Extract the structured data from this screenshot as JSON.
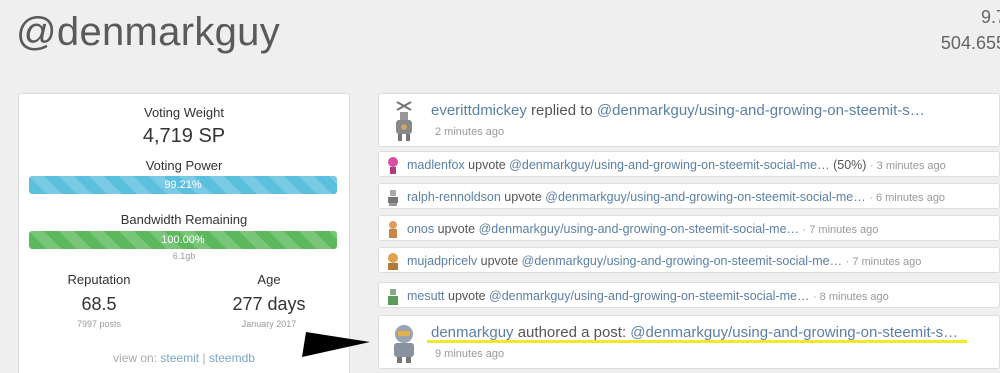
{
  "header": {
    "username": "@denmarkguy",
    "top_right_line1": "9.7",
    "top_right_line2": "504.655"
  },
  "stats": {
    "voting_weight_label": "Voting Weight",
    "voting_weight_value": "4,719 SP",
    "voting_power_label": "Voting Power",
    "voting_power_value": "99.21%",
    "voting_power_fraction": 0.9921,
    "bandwidth_label": "Bandwidth Remaining",
    "bandwidth_value": "100.00%",
    "bandwidth_fraction": 1.0,
    "bandwidth_note": "6.1gb",
    "reputation_label": "Reputation",
    "reputation_value": "68.5",
    "reputation_note": "7997 posts",
    "age_label": "Age",
    "age_value": "277 days",
    "age_note": "January 2017",
    "view_on_prefix": "view on:",
    "view_on_link1": "steemit",
    "view_on_separator": "|",
    "view_on_link2": "steemdb"
  },
  "feed": {
    "item1": {
      "user": "everittdmickey",
      "action": " replied to ",
      "target": "@denmarkguy/using-and-growing-on-steemit-s…",
      "time": "2 minutes ago",
      "avatar": "robot-avatar"
    },
    "item2": {
      "user": "madlenfox",
      "action": " upvote ",
      "target": "@denmarkguy/using-and-growing-on-steemit-social-me…",
      "pct": " (50%) ",
      "time": "· 3 minutes ago",
      "avatar": "pink-avatar"
    },
    "item3": {
      "user": "ralph-rennoldson",
      "action": " upvote ",
      "target": "@denmarkguy/using-and-growing-on-steemit-social-me…",
      "time": "· 6 minutes ago",
      "avatar": "grey-avatar"
    },
    "item4": {
      "user": "onos",
      "action": " upvote ",
      "target": "@denmarkguy/using-and-growing-on-steemit-social-me…",
      "time": "· 7 minutes ago",
      "avatar": "orange-avatar"
    },
    "item5": {
      "user": "mujadpricelv",
      "action": " upvote ",
      "target": "@denmarkguy/using-and-growing-on-steemit-social-me…",
      "time": "· 7 minutes ago",
      "avatar": "orange-avatar"
    },
    "item6": {
      "user": "mesutt",
      "action": " upvote ",
      "target": "@denmarkguy/using-and-growing-on-steemit-social-me…",
      "time": "· 8 minutes ago",
      "avatar": "green-avatar"
    },
    "item7": {
      "user": "denmarkguy",
      "action": " authored a post: ",
      "target": "@denmarkguy/using-and-growing-on-steemit-s…",
      "time": "9 minutes ago",
      "avatar": "robot-avatar"
    }
  },
  "colors": {
    "voting_bar": "#5bc0de",
    "bandwidth_bar": "#5cb85c",
    "link": "#5b7fa6",
    "highlight": "#f5e626"
  }
}
